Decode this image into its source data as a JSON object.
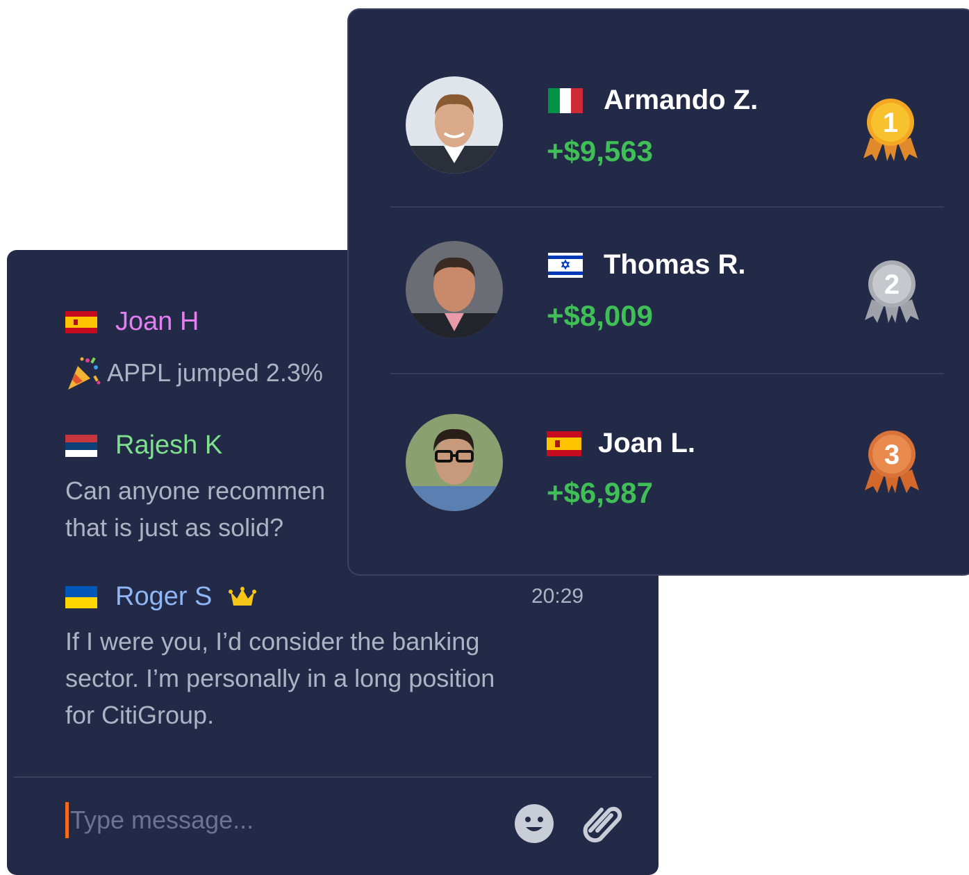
{
  "chat": {
    "messages": [
      {
        "user": "Joan H",
        "flag": "spain",
        "name_color": "#e57ff0",
        "text": "APPL  jumped 2.3%",
        "icon": "party-popper-icon"
      },
      {
        "user": "Rajesh K",
        "flag": "serbia",
        "name_color": "#7ee08c",
        "text": "Can anyone recommen\nthat is just as solid?"
      },
      {
        "user": "Roger S",
        "flag": "ukraine",
        "name_color": "#8fb6f5",
        "badge": "crown-icon",
        "time": "20:29",
        "text": "If I were you, I’d consider the banking\nsector. I’m personally in a long position\nfor CitiGroup."
      }
    ],
    "composer": {
      "placeholder": "Type message..."
    }
  },
  "leaderboard": {
    "rows": [
      {
        "rank": "1",
        "name": "Armando Z.",
        "flag": "italy",
        "profit": "+$9,563",
        "medal": "gold"
      },
      {
        "rank": "2",
        "name": "Thomas R.",
        "flag": "israel",
        "profit": "+$8,009",
        "medal": "silver"
      },
      {
        "rank": "3",
        "name": "Joan L.",
        "flag": "spain",
        "profit": "+$6,987",
        "medal": "bronze"
      }
    ]
  },
  "colors": {
    "panel_bg": "#222a48",
    "profit_green": "#3fbf56",
    "caret_orange": "#f36b1c"
  }
}
